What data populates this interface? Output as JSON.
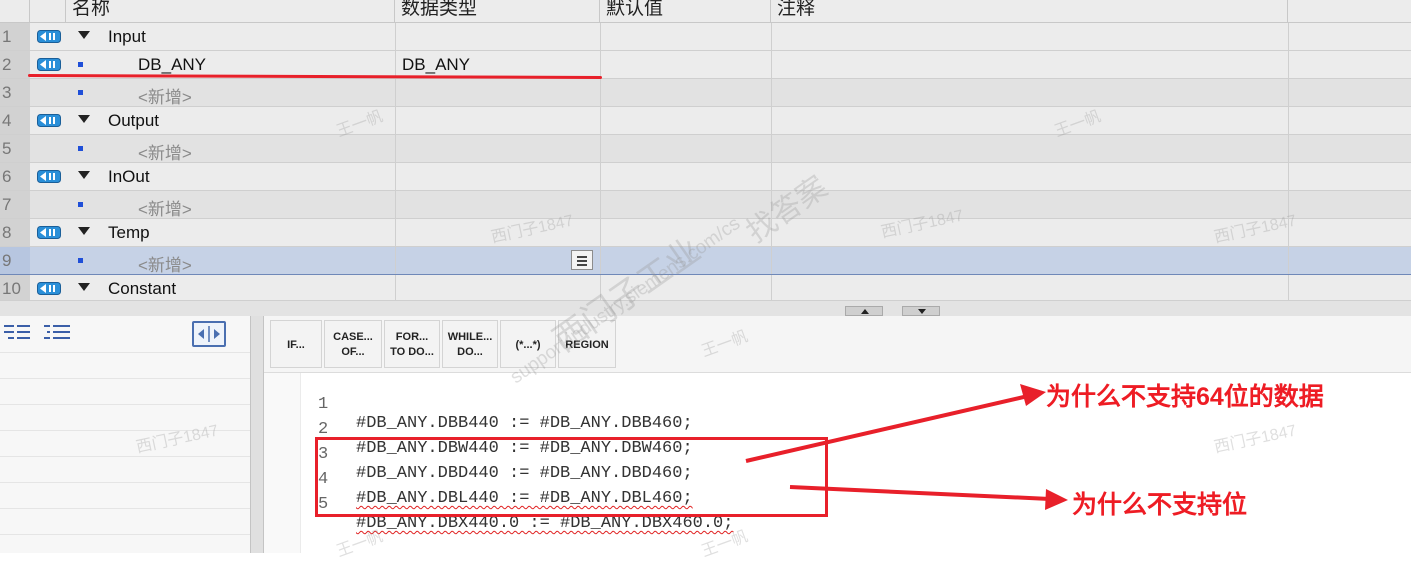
{
  "table": {
    "headers": {
      "name": "名称",
      "datatype": "数据类型",
      "default": "默认值",
      "comment": "注释"
    },
    "rows": [
      {
        "num": "1",
        "kind": "section",
        "label": "Input"
      },
      {
        "num": "2",
        "kind": "var",
        "label": "DB_ANY",
        "type": "DB_ANY"
      },
      {
        "num": "3",
        "kind": "add",
        "label": "<新增>"
      },
      {
        "num": "4",
        "kind": "section",
        "label": "Output"
      },
      {
        "num": "5",
        "kind": "add",
        "label": "<新增>"
      },
      {
        "num": "6",
        "kind": "section",
        "label": "InOut"
      },
      {
        "num": "7",
        "kind": "add",
        "label": "<新增>"
      },
      {
        "num": "8",
        "kind": "section",
        "label": "Temp"
      },
      {
        "num": "9",
        "kind": "add",
        "label": "<新增>",
        "selected": true
      },
      {
        "num": "10",
        "kind": "section",
        "label": "Constant"
      }
    ]
  },
  "toolbar": {
    "buttons": [
      {
        "l1": "IF...",
        "l2": ""
      },
      {
        "l1": "CASE...",
        "l2": "OF..."
      },
      {
        "l1": "FOR...",
        "l2": "TO DO..."
      },
      {
        "l1": "WHILE...",
        "l2": "DO..."
      },
      {
        "l1": "(*...*)",
        "l2": ""
      },
      {
        "l1": "REGION",
        "l2": ""
      }
    ]
  },
  "code": {
    "lines": [
      {
        "no": "1",
        "text": "#DB_ANY.DBB440 := #DB_ANY.DBB460;"
      },
      {
        "no": "2",
        "text": "#DB_ANY.DBW440 := #DB_ANY.DBW460;"
      },
      {
        "no": "3",
        "text": "#DB_ANY.DBD440 := #DB_ANY.DBD460;"
      },
      {
        "no": "4",
        "text": "#DB_ANY.DBL440 := #DB_ANY.DBL460;"
      },
      {
        "no": "5",
        "text": "#DB_ANY.DBX440.0 := #DB_ANY.DBX460.0;"
      }
    ]
  },
  "annotations": {
    "note_64bit": "为什么不支持64位的数据",
    "note_bit": "为什么不支持位",
    "accent_color": "#ee1c24"
  },
  "watermarks": {
    "site": "support.industry.siemens.com/cs",
    "label": "找答案",
    "brand": "西门子工业",
    "user": "西门子1847",
    "author": "王一帆"
  }
}
